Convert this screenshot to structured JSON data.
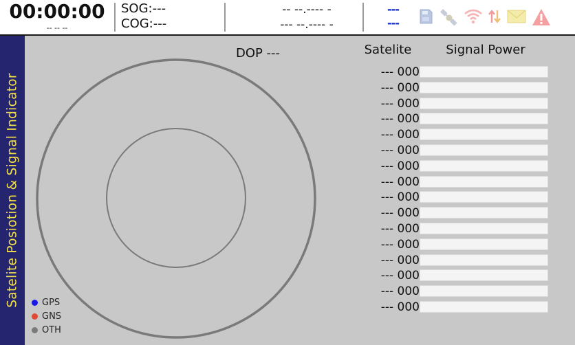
{
  "status_bar": {
    "time": "00:00:00",
    "date": "-- -- --",
    "sog": "SOG:---",
    "cog": "COG:---",
    "latitude": "-- --.---- -",
    "longitude": "--- --.---- -",
    "indicator_top": "---",
    "indicator_bottom": "---",
    "icons": [
      "sd-card-icon",
      "satellite-icon",
      "wifi-icon",
      "transfer-arrows-icon",
      "mail-icon",
      "warning-icon"
    ]
  },
  "sidebar": {
    "title": "Satelite Posiotion & Signal Indicator"
  },
  "sky_plot": {
    "dop_label": "DOP ---"
  },
  "legend": [
    {
      "label": "GPS",
      "color": "#1a1ae6"
    },
    {
      "label": "GNS",
      "color": "#e04a32"
    },
    {
      "label": "OTH",
      "color": "#7a7a7a"
    }
  ],
  "signal_table": {
    "header_satellite": "Satelite",
    "header_signal": "Signal Power",
    "rows": [
      {
        "label": "--- 000",
        "signal": 0
      },
      {
        "label": "--- 000",
        "signal": 0
      },
      {
        "label": "--- 000",
        "signal": 0
      },
      {
        "label": "--- 000",
        "signal": 0
      },
      {
        "label": "--- 000",
        "signal": 0
      },
      {
        "label": "--- 000",
        "signal": 0
      },
      {
        "label": "--- 000",
        "signal": 0
      },
      {
        "label": "--- 000",
        "signal": 0
      },
      {
        "label": "--- 000",
        "signal": 0
      },
      {
        "label": "--- 000",
        "signal": 0
      },
      {
        "label": "--- 000",
        "signal": 0
      },
      {
        "label": "--- 000",
        "signal": 0
      },
      {
        "label": "--- 000",
        "signal": 0
      },
      {
        "label": "--- 000",
        "signal": 0
      },
      {
        "label": "--- 000",
        "signal": 0
      },
      {
        "label": "--- 000",
        "signal": 0
      }
    ]
  },
  "colors": {
    "sidebar_bg": "#24256e",
    "sidebar_text": "#f2e04a",
    "panel_bg": "#c8c8c8",
    "bar_bg": "#f4f4f4",
    "accent_blue": "#1530c8"
  }
}
